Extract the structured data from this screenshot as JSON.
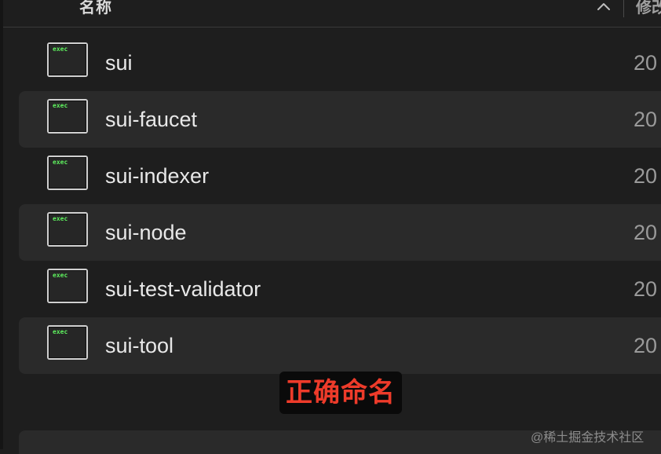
{
  "header": {
    "name_label": "名称",
    "modified_label": "修改"
  },
  "files": [
    {
      "name": "sui",
      "icon": "exec-icon",
      "icon_text": "exec",
      "date": "20"
    },
    {
      "name": "sui-faucet",
      "icon": "exec-icon",
      "icon_text": "exec",
      "date": "20"
    },
    {
      "name": "sui-indexer",
      "icon": "exec-icon",
      "icon_text": "exec",
      "date": "20"
    },
    {
      "name": "sui-node",
      "icon": "exec-icon",
      "icon_text": "exec",
      "date": "20"
    },
    {
      "name": "sui-test-validator",
      "icon": "exec-icon",
      "icon_text": "exec",
      "date": "20"
    },
    {
      "name": "sui-tool",
      "icon": "exec-icon",
      "icon_text": "exec",
      "date": "20"
    }
  ],
  "annotation": "正确命名",
  "watermark": "@稀土掘金技术社区",
  "colors": {
    "background": "#1e1e1e",
    "row_alt": "#2a2a2a",
    "exec_text": "#5ef05e",
    "annotation_text": "#ee3b2a"
  }
}
